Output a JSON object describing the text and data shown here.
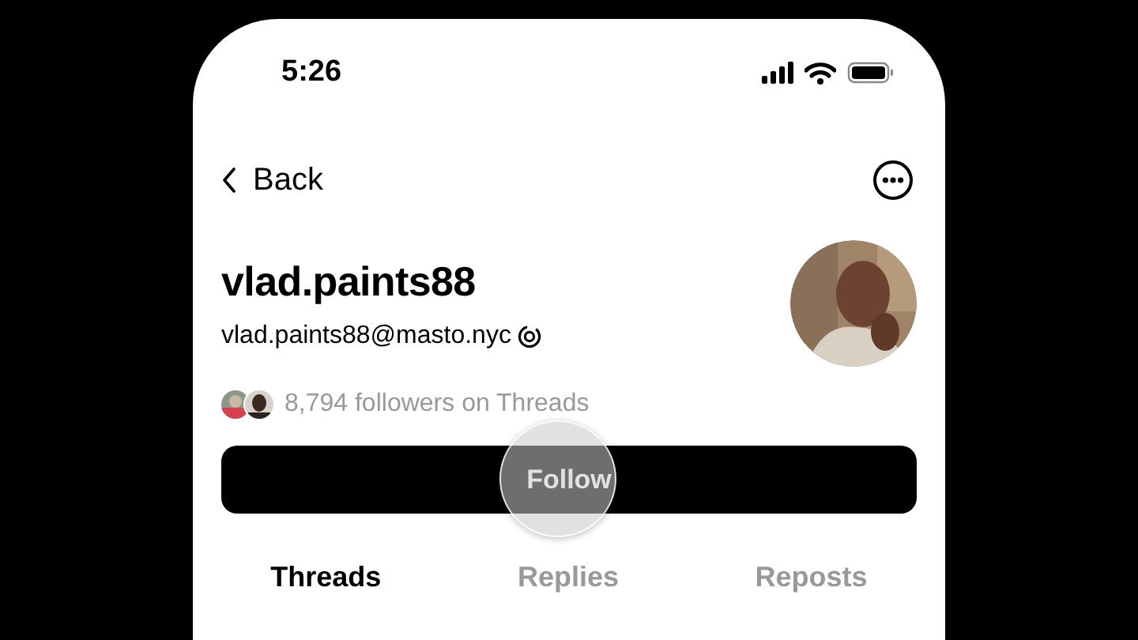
{
  "status_bar": {
    "time": "5:26"
  },
  "nav": {
    "back_label": "Back"
  },
  "profile": {
    "name": "vlad.paints88",
    "handle": "vlad.paints88@masto.nyc",
    "followers_text": "8,794 followers on Threads"
  },
  "follow_button": {
    "label": "Follow",
    "pressed": true
  },
  "tabs": [
    {
      "label": "Threads",
      "selected": true
    },
    {
      "label": "Replies",
      "selected": false
    },
    {
      "label": "Reposts",
      "selected": false
    }
  ]
}
